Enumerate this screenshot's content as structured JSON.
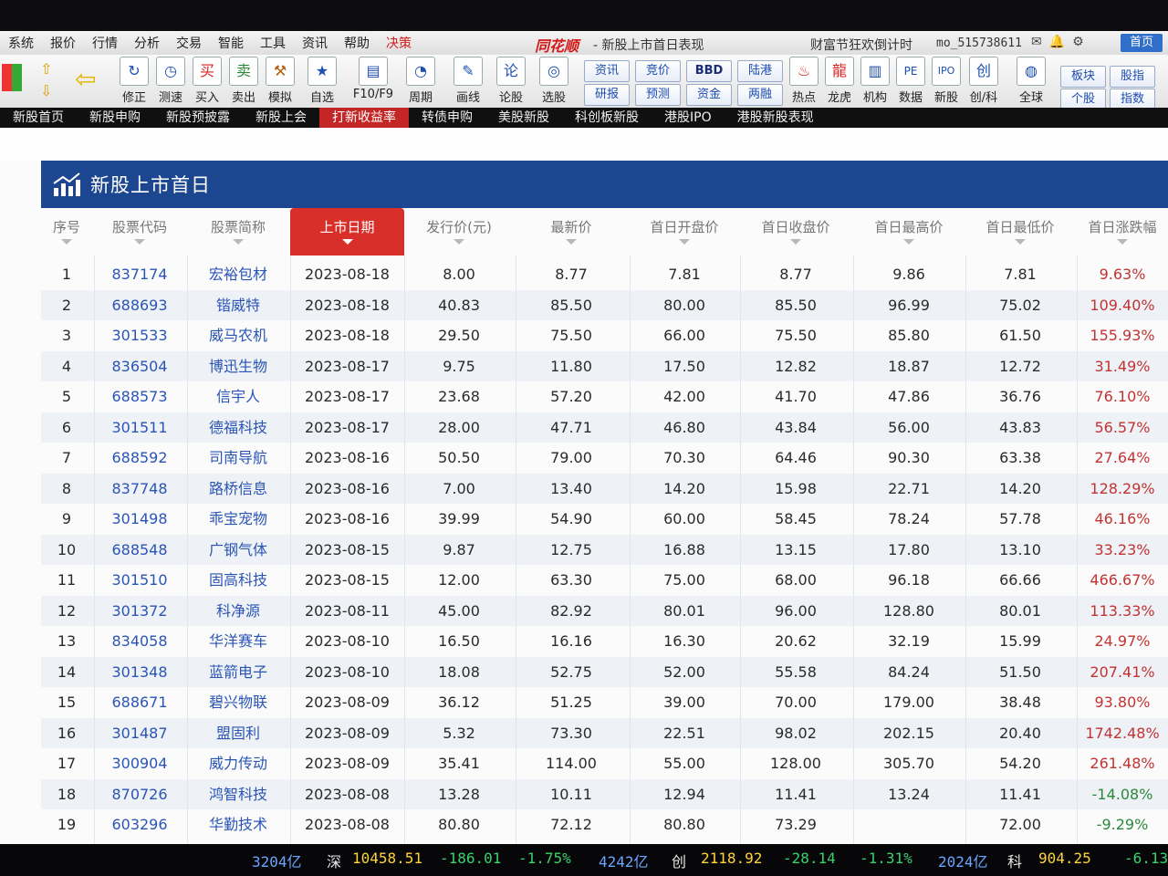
{
  "menu": {
    "items": [
      "系统",
      "报价",
      "行情",
      "分析",
      "交易",
      "智能",
      "工具",
      "资讯",
      "帮助",
      "决策"
    ],
    "brand": "同花顺",
    "window_title": "- 新股上市首日表现",
    "promo": "财富节狂欢倒计时",
    "user": "mo_515738611",
    "home_button": "首页"
  },
  "toolbar": {
    "buttons": [
      "修正",
      "测速",
      "买入",
      "卖出",
      "模拟",
      "自选",
      "F10/F9",
      "周期",
      "画线",
      "论股",
      "选股",
      "热点",
      "龙虎",
      "机构",
      "数据",
      "新股",
      "创/科",
      "全球"
    ],
    "small_buttons": [
      "资讯",
      "竞价",
      "BBD",
      "陆港",
      "研报",
      "预测",
      "资金",
      "两融",
      "板块",
      "股指",
      "个股",
      "指数"
    ]
  },
  "tabs": [
    "新股首页",
    "新股申购",
    "新股预披露",
    "新股上会",
    "打新收益率",
    "转债申购",
    "美股新股",
    "科创板新股",
    "港股IPO",
    "港股新股表现"
  ],
  "panel": {
    "title": "新股上市首日"
  },
  "table": {
    "columns": [
      "序号",
      "股票代码",
      "股票简称",
      "上市日期",
      "发行价(元)",
      "最新价",
      "首日开盘价",
      "首日收盘价",
      "首日最高价",
      "首日最低价",
      "首日涨跌幅"
    ],
    "sorted_column": "上市日期",
    "rows": [
      [
        "1",
        "837174",
        "宏裕包材",
        "2023-08-18",
        "8.00",
        "8.77",
        "7.81",
        "8.77",
        "9.86",
        "7.81",
        "9.63%"
      ],
      [
        "2",
        "688693",
        "锴威特",
        "2023-08-18",
        "40.83",
        "85.50",
        "80.00",
        "85.50",
        "96.99",
        "75.02",
        "109.40%"
      ],
      [
        "3",
        "301533",
        "威马农机",
        "2023-08-18",
        "29.50",
        "75.50",
        "66.00",
        "75.50",
        "85.80",
        "61.50",
        "155.93%"
      ],
      [
        "4",
        "836504",
        "博迅生物",
        "2023-08-17",
        "9.75",
        "11.80",
        "17.50",
        "12.82",
        "18.87",
        "12.72",
        "31.49%"
      ],
      [
        "5",
        "688573",
        "信宇人",
        "2023-08-17",
        "23.68",
        "57.20",
        "42.00",
        "41.70",
        "47.86",
        "36.76",
        "76.10%"
      ],
      [
        "6",
        "301511",
        "德福科技",
        "2023-08-17",
        "28.00",
        "47.71",
        "46.80",
        "43.84",
        "56.00",
        "43.83",
        "56.57%"
      ],
      [
        "7",
        "688592",
        "司南导航",
        "2023-08-16",
        "50.50",
        "79.00",
        "70.30",
        "64.46",
        "90.30",
        "63.38",
        "27.64%"
      ],
      [
        "8",
        "837748",
        "路桥信息",
        "2023-08-16",
        "7.00",
        "13.40",
        "14.20",
        "15.98",
        "22.71",
        "14.20",
        "128.29%"
      ],
      [
        "9",
        "301498",
        "乖宝宠物",
        "2023-08-16",
        "39.99",
        "54.90",
        "60.00",
        "58.45",
        "78.24",
        "57.78",
        "46.16%"
      ],
      [
        "10",
        "688548",
        "广钢气体",
        "2023-08-15",
        "9.87",
        "12.75",
        "16.88",
        "13.15",
        "17.80",
        "13.10",
        "33.23%"
      ],
      [
        "11",
        "301510",
        "固高科技",
        "2023-08-15",
        "12.00",
        "63.30",
        "75.00",
        "68.00",
        "96.18",
        "66.66",
        "466.67%"
      ],
      [
        "12",
        "301372",
        "科净源",
        "2023-08-11",
        "45.00",
        "82.92",
        "80.01",
        "96.00",
        "128.80",
        "80.01",
        "113.33%"
      ],
      [
        "13",
        "834058",
        "华洋赛车",
        "2023-08-10",
        "16.50",
        "16.16",
        "16.30",
        "20.62",
        "32.19",
        "15.99",
        "24.97%"
      ],
      [
        "14",
        "301348",
        "蓝箭电子",
        "2023-08-10",
        "18.08",
        "52.75",
        "52.00",
        "55.58",
        "84.24",
        "51.50",
        "207.41%"
      ],
      [
        "15",
        "688671",
        "碧兴物联",
        "2023-08-09",
        "36.12",
        "51.25",
        "39.00",
        "70.00",
        "179.00",
        "38.48",
        "93.80%"
      ],
      [
        "16",
        "301487",
        "盟固利",
        "2023-08-09",
        "5.32",
        "73.30",
        "22.51",
        "98.02",
        "202.15",
        "20.40",
        "1742.48%"
      ],
      [
        "17",
        "300904",
        "威力传动",
        "2023-08-09",
        "35.41",
        "114.00",
        "55.00",
        "128.00",
        "305.70",
        "54.20",
        "261.48%"
      ],
      [
        "18",
        "870726",
        "鸿智科技",
        "2023-08-08",
        "13.28",
        "10.11",
        "12.94",
        "11.41",
        "13.24",
        "11.41",
        "-14.08%"
      ],
      [
        "19",
        "603296",
        "华勤技术",
        "2023-08-08",
        "80.80",
        "72.12",
        "80.80",
        "73.29",
        "",
        "72.00",
        "-9.29%"
      ]
    ]
  },
  "statusbar": {
    "sh_amount": "3204亿",
    "sz_label": "深",
    "sz_index": "10458.51",
    "sz_change": "-186.01",
    "sz_pct": "-1.75%",
    "sz_amount": "4242亿",
    "cy_label": "创",
    "cy_index": "2118.92",
    "cy_change": "-28.14",
    "cy_pct": "-1.31%",
    "cy_amount": "2024亿",
    "kc_label": "科",
    "kc_index": "904.25",
    "kc_change": "-6.13"
  },
  "colors": {
    "header_blue": "#1d4690",
    "sort_red": "#d92f2a",
    "tab_active": "#c42525"
  }
}
